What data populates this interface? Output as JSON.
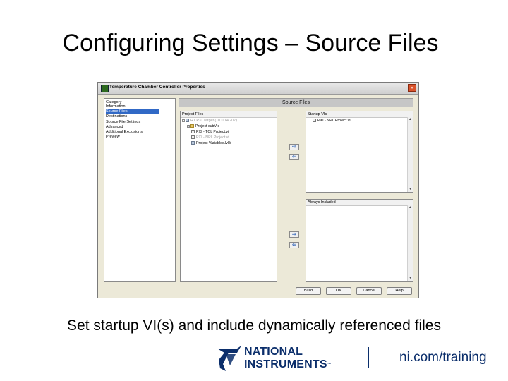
{
  "slide": {
    "title": "Configuring Settings – Source Files",
    "caption": "Set startup VI(s) and include dynamically referenced files",
    "footer_url": "ni.com/training",
    "logo": {
      "line1": "NATIONAL",
      "line2": "INSTRUMENTS",
      "tm": "™"
    }
  },
  "dialog": {
    "title": "Temperature Chamber Controller Properties",
    "close_glyph": "×",
    "category_label": "Category",
    "categories": [
      "Information",
      "Source Files",
      "Destinations",
      "Source File Settings",
      "Advanced",
      "Additional Exclusions",
      "Preview"
    ],
    "selected_category": "Source Files",
    "section_header": "Source Files",
    "project_files": {
      "label": "Project Files",
      "items": [
        {
          "text": "RT PXI Target (10.0.14.207)",
          "dim": true
        },
        {
          "text": "Project subVIs",
          "dim": false
        },
        {
          "text": "PXI - TCL Project.vi",
          "dim": false
        },
        {
          "text": "PXI - NPL Project.vi",
          "dim": true
        },
        {
          "text": "Project Variables.lvlib",
          "dim": false
        }
      ]
    },
    "startup_vis": {
      "label": "Startup VIs",
      "items": [
        "PXI - NPL Project.vi"
      ]
    },
    "always_included": {
      "label": "Always Included",
      "items": []
    },
    "arrows": {
      "add": "⇨",
      "remove": "⇦"
    },
    "buttons": {
      "build": "Build",
      "ok": "OK",
      "cancel": "Cancel",
      "help": "Help"
    }
  },
  "colors": {
    "selection": "#3169c6",
    "brand_navy": "#0b2e6b",
    "window_face": "#ece9d8"
  }
}
